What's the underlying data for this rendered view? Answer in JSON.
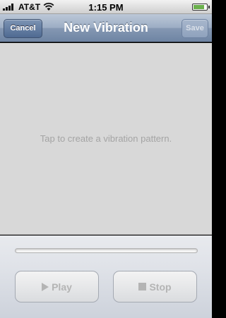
{
  "status_bar": {
    "carrier": "AT&T",
    "time": "1:15 PM",
    "signal_bars": 4,
    "battery_level": 0.85,
    "battery_color": "#6ab04c"
  },
  "nav": {
    "title": "New Vibration",
    "cancel_label": "Cancel",
    "save_label": "Save",
    "save_enabled": false
  },
  "canvas": {
    "hint": "Tap to create a vibration pattern."
  },
  "playback": {
    "progress": 0,
    "play_label": "Play",
    "stop_label": "Stop",
    "play_enabled": false,
    "stop_enabled": false,
    "accent": "#4a78c7"
  }
}
